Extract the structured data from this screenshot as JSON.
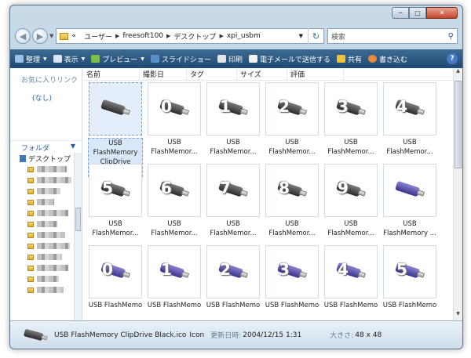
{
  "window": {
    "minimize": "─",
    "maximize": "□",
    "close": "✕"
  },
  "address": {
    "chevron": "«",
    "crumbs": [
      "ユーザー",
      "freesoft100",
      "デスクトップ",
      "xpi_usbm"
    ],
    "search_placeholder": "検索"
  },
  "toolbar": {
    "organize": "整理",
    "views": "表示",
    "preview": "プレビュー",
    "slideshow": "スライドショー",
    "print": "印刷",
    "email": "電子メールで送信する",
    "share": "共有",
    "burn": "書き込む",
    "help": "?"
  },
  "nav": {
    "favorites_title": "お気に入りリンク",
    "favorites_none": "(なし)",
    "folders_title": "フォルダ",
    "desktop_label": "デスクトップ"
  },
  "columns": [
    "名前",
    "撮影日",
    "タグ",
    "サイズ",
    "評価"
  ],
  "files": [
    {
      "label": "USB FlashMemory ClipDrive Black.ico",
      "digit": "",
      "color": "black",
      "selected": true
    },
    {
      "label": "USB FlashMemor...",
      "digit": "0",
      "color": "black"
    },
    {
      "label": "USB FlashMemor...",
      "digit": "1",
      "color": "black"
    },
    {
      "label": "USB FlashMemor...",
      "digit": "2",
      "color": "black"
    },
    {
      "label": "USB FlashMemor...",
      "digit": "3",
      "color": "black"
    },
    {
      "label": "USB FlashMemor...",
      "digit": "4",
      "color": "black"
    },
    {
      "label": "USB FlashMemor...",
      "digit": "5",
      "color": "black"
    },
    {
      "label": "USB FlashMemor...",
      "digit": "6",
      "color": "black"
    },
    {
      "label": "USB FlashMemor...",
      "digit": "7",
      "color": "black"
    },
    {
      "label": "USB FlashMemor...",
      "digit": "8",
      "color": "black"
    },
    {
      "label": "USB FlashMemor...",
      "digit": "9",
      "color": "black"
    },
    {
      "label": "USB FlashMemory ...",
      "digit": "",
      "color": "purple"
    },
    {
      "label": "USB FlashMemo",
      "digit": "0",
      "color": "purple"
    },
    {
      "label": "USB FlashMemo",
      "digit": "1",
      "color": "purple"
    },
    {
      "label": "USB FlashMemo",
      "digit": "2",
      "color": "purple"
    },
    {
      "label": "USB FlashMemo",
      "digit": "3",
      "color": "purple"
    },
    {
      "label": "USB FlashMemo",
      "digit": "4",
      "color": "purple"
    },
    {
      "label": "USB FlashMemo",
      "digit": "5",
      "color": "purple"
    }
  ],
  "details": {
    "name": "USB FlashMemory ClipDrive Black.ico",
    "type": "Icon",
    "modified_label": "更新日時:",
    "modified_value": "2004/12/15 1:31",
    "size_label": "大きさ:",
    "size_value": "48 x 48"
  }
}
